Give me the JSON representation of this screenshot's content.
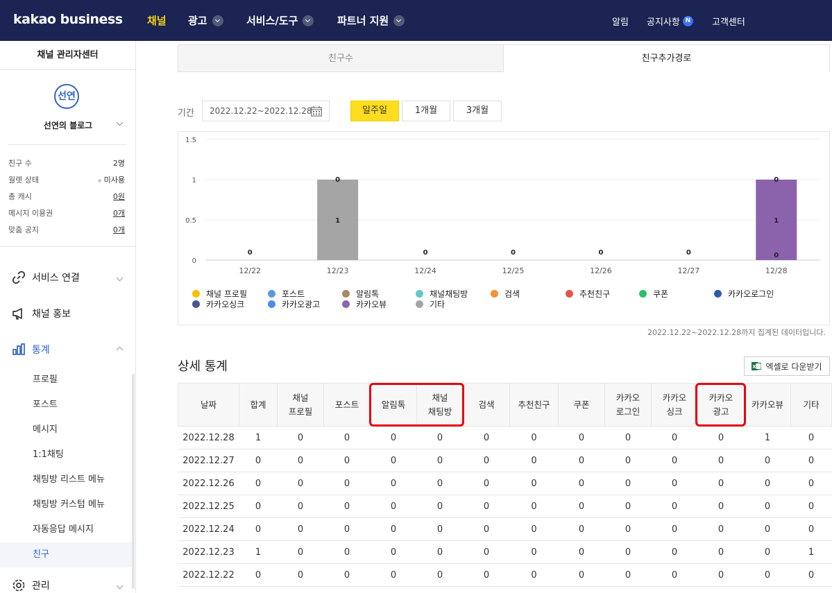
{
  "topnav": {
    "logo": "kakao business",
    "items": [
      {
        "label": "채널",
        "active": true
      },
      {
        "label": "광고",
        "dropdown": true
      },
      {
        "label": "서비스/도구",
        "dropdown": true
      },
      {
        "label": "파트너 지원",
        "dropdown": true
      }
    ],
    "right": {
      "alert": "알림",
      "notice": "공지사항",
      "notice_badge": "N",
      "support": "고객센터"
    }
  },
  "sidebar": {
    "title": "채널 관리자센터",
    "avatar_text": "선연",
    "channel_name": "선연의 블로그",
    "info": [
      {
        "label": "친구 수",
        "value": "2명"
      },
      {
        "label": "월렛 상태",
        "value": "미사용"
      },
      {
        "label": "총 캐시",
        "value": "0원"
      },
      {
        "label": "메시지 이용권",
        "value": "0개"
      },
      {
        "label": "맞춤 공지",
        "value": "0개"
      }
    ],
    "menu": {
      "service": "서비스 연결",
      "promo": "채널 홍보",
      "stats": "통계",
      "manage": "관리"
    },
    "submenu": [
      "프로필",
      "포스트",
      "메시지",
      "1:1채팅",
      "채팅방 리스트 메뉴",
      "채팅방 커스텀 메뉴",
      "자동응답 메시지",
      "친구"
    ]
  },
  "tabs": {
    "friends": "친구수",
    "route": "친구추가경로"
  },
  "period": {
    "label": "기간",
    "range": "2022.12.22~2022.12.28",
    "buttons": {
      "week": "일주일",
      "month1": "1개월",
      "month3": "3개월"
    }
  },
  "chart_data": {
    "type": "bar",
    "stacked": true,
    "categories": [
      "12/22",
      "12/23",
      "12/24",
      "12/25",
      "12/26",
      "12/27",
      "12/28"
    ],
    "ylim": [
      0,
      1.5
    ],
    "yticks": [
      "0",
      "0.5",
      "1",
      "1.5"
    ],
    "series": [
      {
        "name": "기타",
        "color": "#a5a5a5",
        "values": [
          0,
          1,
          0,
          0,
          0,
          0,
          0
        ]
      },
      {
        "name": "카카오뷰",
        "color": "#8b63ad",
        "values": [
          0,
          0,
          0,
          0,
          0,
          0,
          1
        ]
      }
    ],
    "data_labels": [
      {
        "top": "0",
        "mid": "",
        "base": ""
      },
      {
        "top": "0",
        "mid": "1",
        "base": ""
      },
      {
        "top": "0",
        "mid": "",
        "base": ""
      },
      {
        "top": "0",
        "mid": "",
        "base": ""
      },
      {
        "top": "0",
        "mid": "",
        "base": ""
      },
      {
        "top": "0",
        "mid": "",
        "base": ""
      },
      {
        "top": "0",
        "mid": "1",
        "base": "0"
      }
    ]
  },
  "legend": [
    {
      "name": "채널 프로필",
      "color": "#f6c100"
    },
    {
      "name": "포스트",
      "color": "#5b9bd5"
    },
    {
      "name": "알림톡",
      "color": "#a68a64"
    },
    {
      "name": "채널채팅방",
      "color": "#63c8c3"
    },
    {
      "name": "검색",
      "color": "#f29333"
    },
    {
      "name": "추천친구",
      "color": "#e15747"
    },
    {
      "name": "쿠폰",
      "color": "#2fbf6a"
    },
    {
      "name": "카카오로그인",
      "color": "#2f5aa8"
    },
    {
      "name": "카카오싱크",
      "color": "#4c5595"
    },
    {
      "name": "카카오광고",
      "color": "#4b8bf0"
    },
    {
      "name": "카카오뷰",
      "color": "#8b63ad"
    },
    {
      "name": "기타",
      "color": "#a5a5a5"
    }
  ],
  "footnote": "2022.12.22~2022.12.28까지 집계된 데이터입니다.",
  "detail": {
    "title": "상세 통계",
    "excel": "엑셀로 다운받기",
    "headers": [
      "날짜",
      "합계",
      "채널\n프로필",
      "포스트",
      "알림톡",
      "채널\n채팅방",
      "검색",
      "추천친구",
      "쿠폰",
      "카카오\n로그인",
      "카카오\n싱크",
      "카카오\n광고",
      "카카오뷰",
      "기타"
    ],
    "rows": [
      [
        "2022.12.28",
        "1",
        "0",
        "0",
        "0",
        "0",
        "0",
        "0",
        "0",
        "0",
        "0",
        "0",
        "1",
        "0"
      ],
      [
        "2022.12.27",
        "0",
        "0",
        "0",
        "0",
        "0",
        "0",
        "0",
        "0",
        "0",
        "0",
        "0",
        "0",
        "0"
      ],
      [
        "2022.12.26",
        "0",
        "0",
        "0",
        "0",
        "0",
        "0",
        "0",
        "0",
        "0",
        "0",
        "0",
        "0",
        "0"
      ],
      [
        "2022.12.25",
        "0",
        "0",
        "0",
        "0",
        "0",
        "0",
        "0",
        "0",
        "0",
        "0",
        "0",
        "0",
        "0"
      ],
      [
        "2022.12.24",
        "0",
        "0",
        "0",
        "0",
        "0",
        "0",
        "0",
        "0",
        "0",
        "0",
        "0",
        "0",
        "0"
      ],
      [
        "2022.12.23",
        "1",
        "0",
        "0",
        "0",
        "0",
        "0",
        "0",
        "0",
        "0",
        "0",
        "0",
        "0",
        "1"
      ],
      [
        "2022.12.22",
        "0",
        "0",
        "0",
        "0",
        "0",
        "0",
        "0",
        "0",
        "0",
        "0",
        "0",
        "0",
        "0"
      ]
    ]
  }
}
